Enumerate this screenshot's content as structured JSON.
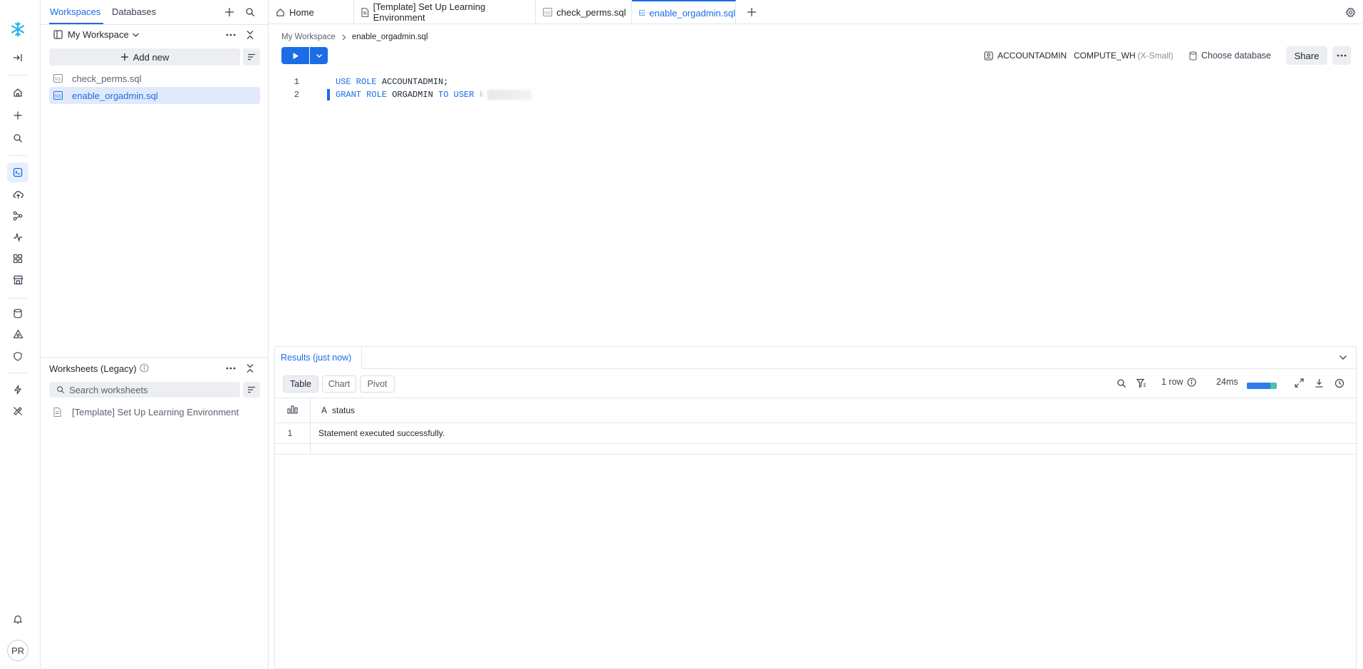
{
  "explorer": {
    "tabs": [
      "Workspaces",
      "Databases"
    ],
    "workspace_name": "My Workspace",
    "add_new_label": "Add new",
    "files": [
      {
        "name": "check_perms.sql",
        "active": false
      },
      {
        "name": "enable_orgadmin.sql",
        "active": true
      }
    ],
    "legacy": {
      "title": "Worksheets (Legacy)",
      "search_placeholder": "Search worksheets",
      "items": [
        "[Template] Set Up Learning Environment"
      ]
    }
  },
  "tabs": [
    {
      "label": "Home",
      "icon": "home-icon",
      "active": false
    },
    {
      "label": "[Template] Set Up Learning Environment",
      "icon": "document-icon",
      "active": false
    },
    {
      "label": "check_perms.sql",
      "icon": "sql-file-icon",
      "active": false
    },
    {
      "label": "enable_orgadmin.sql",
      "icon": "sql-file-icon",
      "active": true
    }
  ],
  "breadcrumb": {
    "root": "My Workspace",
    "current": "enable_orgadmin.sql"
  },
  "context": {
    "role": "ACCOUNTADMIN",
    "warehouse": "COMPUTE_WH",
    "warehouse_size": "(X-Small)",
    "database_label": "Choose database",
    "share_label": "Share"
  },
  "editor": {
    "lines": [
      {
        "number": "1",
        "tokens": [
          {
            "t": "USE ROLE ",
            "k": "kw"
          },
          {
            "t": "ACCOUNTADMIN;",
            "k": "id"
          }
        ]
      },
      {
        "number": "2",
        "tokens": [
          {
            "t": "GRANT ROLE ",
            "k": "kw"
          },
          {
            "t": "ORGADMIN ",
            "k": "id"
          },
          {
            "t": "TO USER ",
            "k": "kw"
          },
          {
            "t": "k",
            "k": "id"
          }
        ]
      }
    ]
  },
  "results": {
    "tab_label": "Results (just now)",
    "views": [
      "Table",
      "Chart",
      "Pivot"
    ],
    "active_view": "Table",
    "row_count_label": "1 row",
    "duration_label": "24ms",
    "duration_progress": 0.78,
    "columns": [
      "status"
    ],
    "rows": [
      {
        "index": "1",
        "status": "Statement executed successfully."
      }
    ]
  },
  "user": {
    "initials": "PR"
  },
  "colors": {
    "accent": "#1a6ce7",
    "logo": "#29b5e8",
    "progress_secondary": "#47c5a6"
  }
}
